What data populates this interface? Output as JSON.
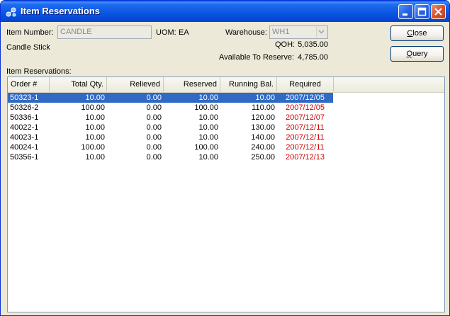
{
  "window": {
    "title": "Item Reservations"
  },
  "form": {
    "item_number_label": "Item Number:",
    "item_number_value": "CANDLE",
    "uom_label": "UOM:",
    "uom_value": "EA",
    "description": "Candle Stick",
    "warehouse_label": "Warehouse:",
    "warehouse_value": "WH1",
    "qoh_label": "QOH:",
    "qoh_value": "5,035.00",
    "available_label": "Available To Reserve:",
    "available_value": "4,785.00"
  },
  "buttons": {
    "close_label": "Close",
    "close_mnemonic": "C",
    "query_label": "Query",
    "query_mnemonic": "Q"
  },
  "table": {
    "title": "Item Reservations:",
    "columns": [
      "Order #",
      "Total Qty.",
      "Relieved",
      "Reserved",
      "Running Bal.",
      "Required"
    ],
    "rows": [
      {
        "order": "50323-1",
        "total": "10.00",
        "relieved": "0.00",
        "reserved": "10.00",
        "running": "10.00",
        "required": "2007/12/05",
        "selected": true
      },
      {
        "order": "50326-2",
        "total": "100.00",
        "relieved": "0.00",
        "reserved": "100.00",
        "running": "110.00",
        "required": "2007/12/05",
        "selected": false
      },
      {
        "order": "50336-1",
        "total": "10.00",
        "relieved": "0.00",
        "reserved": "10.00",
        "running": "120.00",
        "required": "2007/12/07",
        "selected": false
      },
      {
        "order": "40022-1",
        "total": "10.00",
        "relieved": "0.00",
        "reserved": "10.00",
        "running": "130.00",
        "required": "2007/12/11",
        "selected": false
      },
      {
        "order": "40023-1",
        "total": "10.00",
        "relieved": "0.00",
        "reserved": "10.00",
        "running": "140.00",
        "required": "2007/12/11",
        "selected": false
      },
      {
        "order": "40024-1",
        "total": "100.00",
        "relieved": "0.00",
        "reserved": "100.00",
        "running": "240.00",
        "required": "2007/12/11",
        "selected": false
      },
      {
        "order": "50356-1",
        "total": "10.00",
        "relieved": "0.00",
        "reserved": "10.00",
        "running": "250.00",
        "required": "2007/12/13",
        "selected": false
      }
    ]
  },
  "colors": {
    "title_bar": "#0a55e0",
    "selection": "#316ac5",
    "overdue_date": "#d00000",
    "window_bg": "#ece9d8"
  },
  "icons": {
    "app": "reservations-icon",
    "minimize": "minimize-icon",
    "maximize": "maximize-icon",
    "close": "close-icon"
  }
}
